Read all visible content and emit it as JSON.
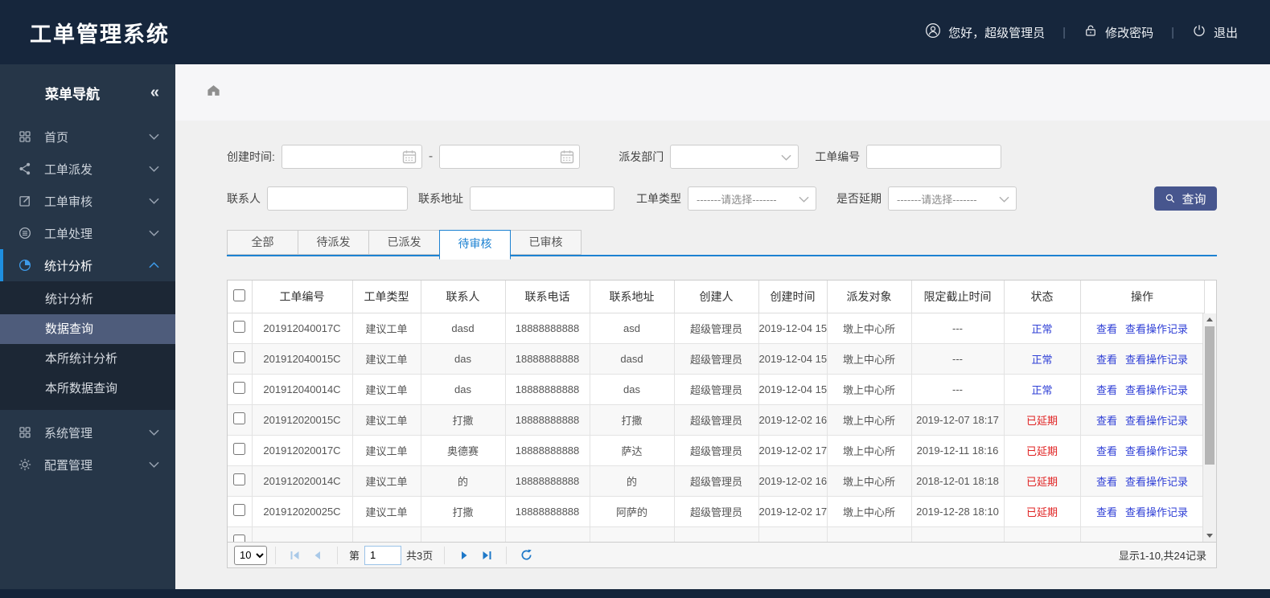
{
  "header": {
    "title": "工单管理系统",
    "greeting": "您好，超级管理员",
    "change_password": "修改密码",
    "logout": "退出"
  },
  "sidebar": {
    "title": "菜单导航",
    "collapse_icon": "«",
    "items": [
      {
        "label": "首页",
        "icon": "grid-icon"
      },
      {
        "label": "工单派发",
        "icon": "share-icon"
      },
      {
        "label": "工单审核",
        "icon": "edit-icon"
      },
      {
        "label": "工单处理",
        "icon": "coins-icon"
      },
      {
        "label": "统计分析",
        "icon": "pie-chart-icon",
        "active": true,
        "expanded": true,
        "children": [
          {
            "label": "统计分析"
          },
          {
            "label": "数据查询",
            "selected": true
          },
          {
            "label": "本所统计分析"
          },
          {
            "label": "本所数据查询"
          }
        ]
      },
      {
        "label": "系统管理",
        "icon": "grid-icon"
      },
      {
        "label": "配置管理",
        "icon": "gear-icon"
      }
    ]
  },
  "filters": {
    "created_time_label": "创建时间:",
    "date_separator": "-",
    "dispatch_dept_label": "派发部门",
    "order_no_label": "工单编号",
    "contact_label": "联系人",
    "contact_addr_label": "联系地址",
    "order_type_label": "工单类型",
    "delayed_label": "是否延期",
    "select_placeholder": "-------请选择-------",
    "search_button": "查询"
  },
  "tabs": [
    {
      "label": "全部"
    },
    {
      "label": "待派发"
    },
    {
      "label": "已派发"
    },
    {
      "label": "待审核",
      "active": true
    },
    {
      "label": "已审核"
    }
  ],
  "table": {
    "columns": [
      "工单编号",
      "工单类型",
      "联系人",
      "联系电话",
      "联系地址",
      "创建人",
      "创建时间",
      "派发对象",
      "限定截止时间",
      "状态",
      "操作"
    ],
    "actions": {
      "view": "查看",
      "log": "查看操作记录"
    },
    "rows": [
      {
        "order_no": "201912040017C",
        "order_type": "建议工单",
        "contact": "dasd",
        "phone": "18888888888",
        "address": "asd",
        "creator": "超级管理员",
        "created_at": "2019-12-04 15:",
        "dispatch_to": "墩上中心所",
        "deadline": "---",
        "status": "正常",
        "status_type": "status-normal"
      },
      {
        "order_no": "201912040015C",
        "order_type": "建议工单",
        "contact": "das",
        "phone": "18888888888",
        "address": "dasd",
        "creator": "超级管理员",
        "created_at": "2019-12-04 15:",
        "dispatch_to": "墩上中心所",
        "deadline": "---",
        "status": "正常",
        "status_type": "status-normal"
      },
      {
        "order_no": "201912040014C",
        "order_type": "建议工单",
        "contact": "das",
        "phone": "18888888888",
        "address": "das",
        "creator": "超级管理员",
        "created_at": "2019-12-04 15:",
        "dispatch_to": "墩上中心所",
        "deadline": "---",
        "status": "正常",
        "status_type": "status-normal"
      },
      {
        "order_no": "201912020015C",
        "order_type": "建议工单",
        "contact": "打撒",
        "phone": "18888888888",
        "address": "打撒",
        "creator": "超级管理员",
        "created_at": "2019-12-02 16:",
        "dispatch_to": "墩上中心所",
        "deadline": "2019-12-07 18:17",
        "status": "已延期",
        "status_type": "status-delayed"
      },
      {
        "order_no": "201912020017C",
        "order_type": "建议工单",
        "contact": "奥德赛",
        "phone": "18888888888",
        "address": "萨达",
        "creator": "超级管理员",
        "created_at": "2019-12-02 17:",
        "dispatch_to": "墩上中心所",
        "deadline": "2019-12-11 18:16",
        "status": "已延期",
        "status_type": "status-delayed"
      },
      {
        "order_no": "201912020014C",
        "order_type": "建议工单",
        "contact": "的",
        "phone": "18888888888",
        "address": "的",
        "creator": "超级管理员",
        "created_at": "2019-12-02 16:",
        "dispatch_to": "墩上中心所",
        "deadline": "2018-12-01 18:18",
        "status": "已延期",
        "status_type": "status-delayed"
      },
      {
        "order_no": "201912020025C",
        "order_type": "建议工单",
        "contact": "打撒",
        "phone": "18888888888",
        "address": "阿萨的",
        "creator": "超级管理员",
        "created_at": "2019-12-02 17:",
        "dispatch_to": "墩上中心所",
        "deadline": "2019-12-28 18:10",
        "status": "已延期",
        "status_type": "status-delayed"
      }
    ]
  },
  "pagination": {
    "page_size": "10",
    "page_prefix": "第",
    "page_value": "1",
    "total_pages": "共3页",
    "summary": "显示1-10,共24记录"
  },
  "colors": {
    "header_bg": "#16263c",
    "sidebar_bg": "#263648",
    "accent_blue": "#1d82d2",
    "link_blue": "#2e3ed6",
    "danger_red": "#e02222",
    "button_bg": "#47568e"
  }
}
